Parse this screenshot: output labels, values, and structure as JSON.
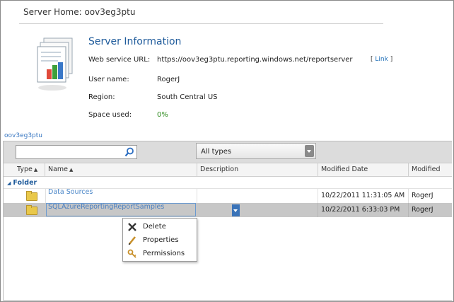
{
  "header": {
    "title": "Server Home: oov3eg3ptu"
  },
  "server_info": {
    "title": "Server Information",
    "rows": [
      {
        "label": "Web service URL:",
        "value": "https://oov3eg3ptu.reporting.windows.net/reportserver"
      },
      {
        "label": "User name:",
        "value": "RogerJ"
      },
      {
        "label": "Region:",
        "value": "South Central US"
      },
      {
        "label": "Space used:",
        "value": "0%"
      }
    ],
    "link_open": "[",
    "link_label": "Link",
    "link_close": "]",
    "space_color": "#2e8b1e"
  },
  "breadcrumb": "oov3eg3ptu",
  "toolbar": {
    "search_placeholder": "",
    "type_filter": "All types"
  },
  "columns": [
    {
      "label": "Type",
      "sort": "▲"
    },
    {
      "label": "Name",
      "sort": "▲"
    },
    {
      "label": "Description",
      "sort": ""
    },
    {
      "label": "Modified Date",
      "sort": ""
    },
    {
      "label": "Modified",
      "sort": ""
    }
  ],
  "group": {
    "label": "Folder"
  },
  "rows": [
    {
      "name": "Data Sources",
      "description": "",
      "modified_date": "10/22/2011 11:31:05 AM",
      "modified_by": "RogerJ"
    },
    {
      "name": "SQLAzureReportingReportSamples",
      "description": "",
      "modified_date": "10/22/2011 6:33:03 PM",
      "modified_by": "RogerJ"
    }
  ],
  "context_menu": [
    {
      "label": "Delete",
      "icon": "delete-x-icon"
    },
    {
      "label": "Properties",
      "icon": "pencil-icon"
    },
    {
      "label": "Permissions",
      "icon": "keys-icon"
    }
  ]
}
